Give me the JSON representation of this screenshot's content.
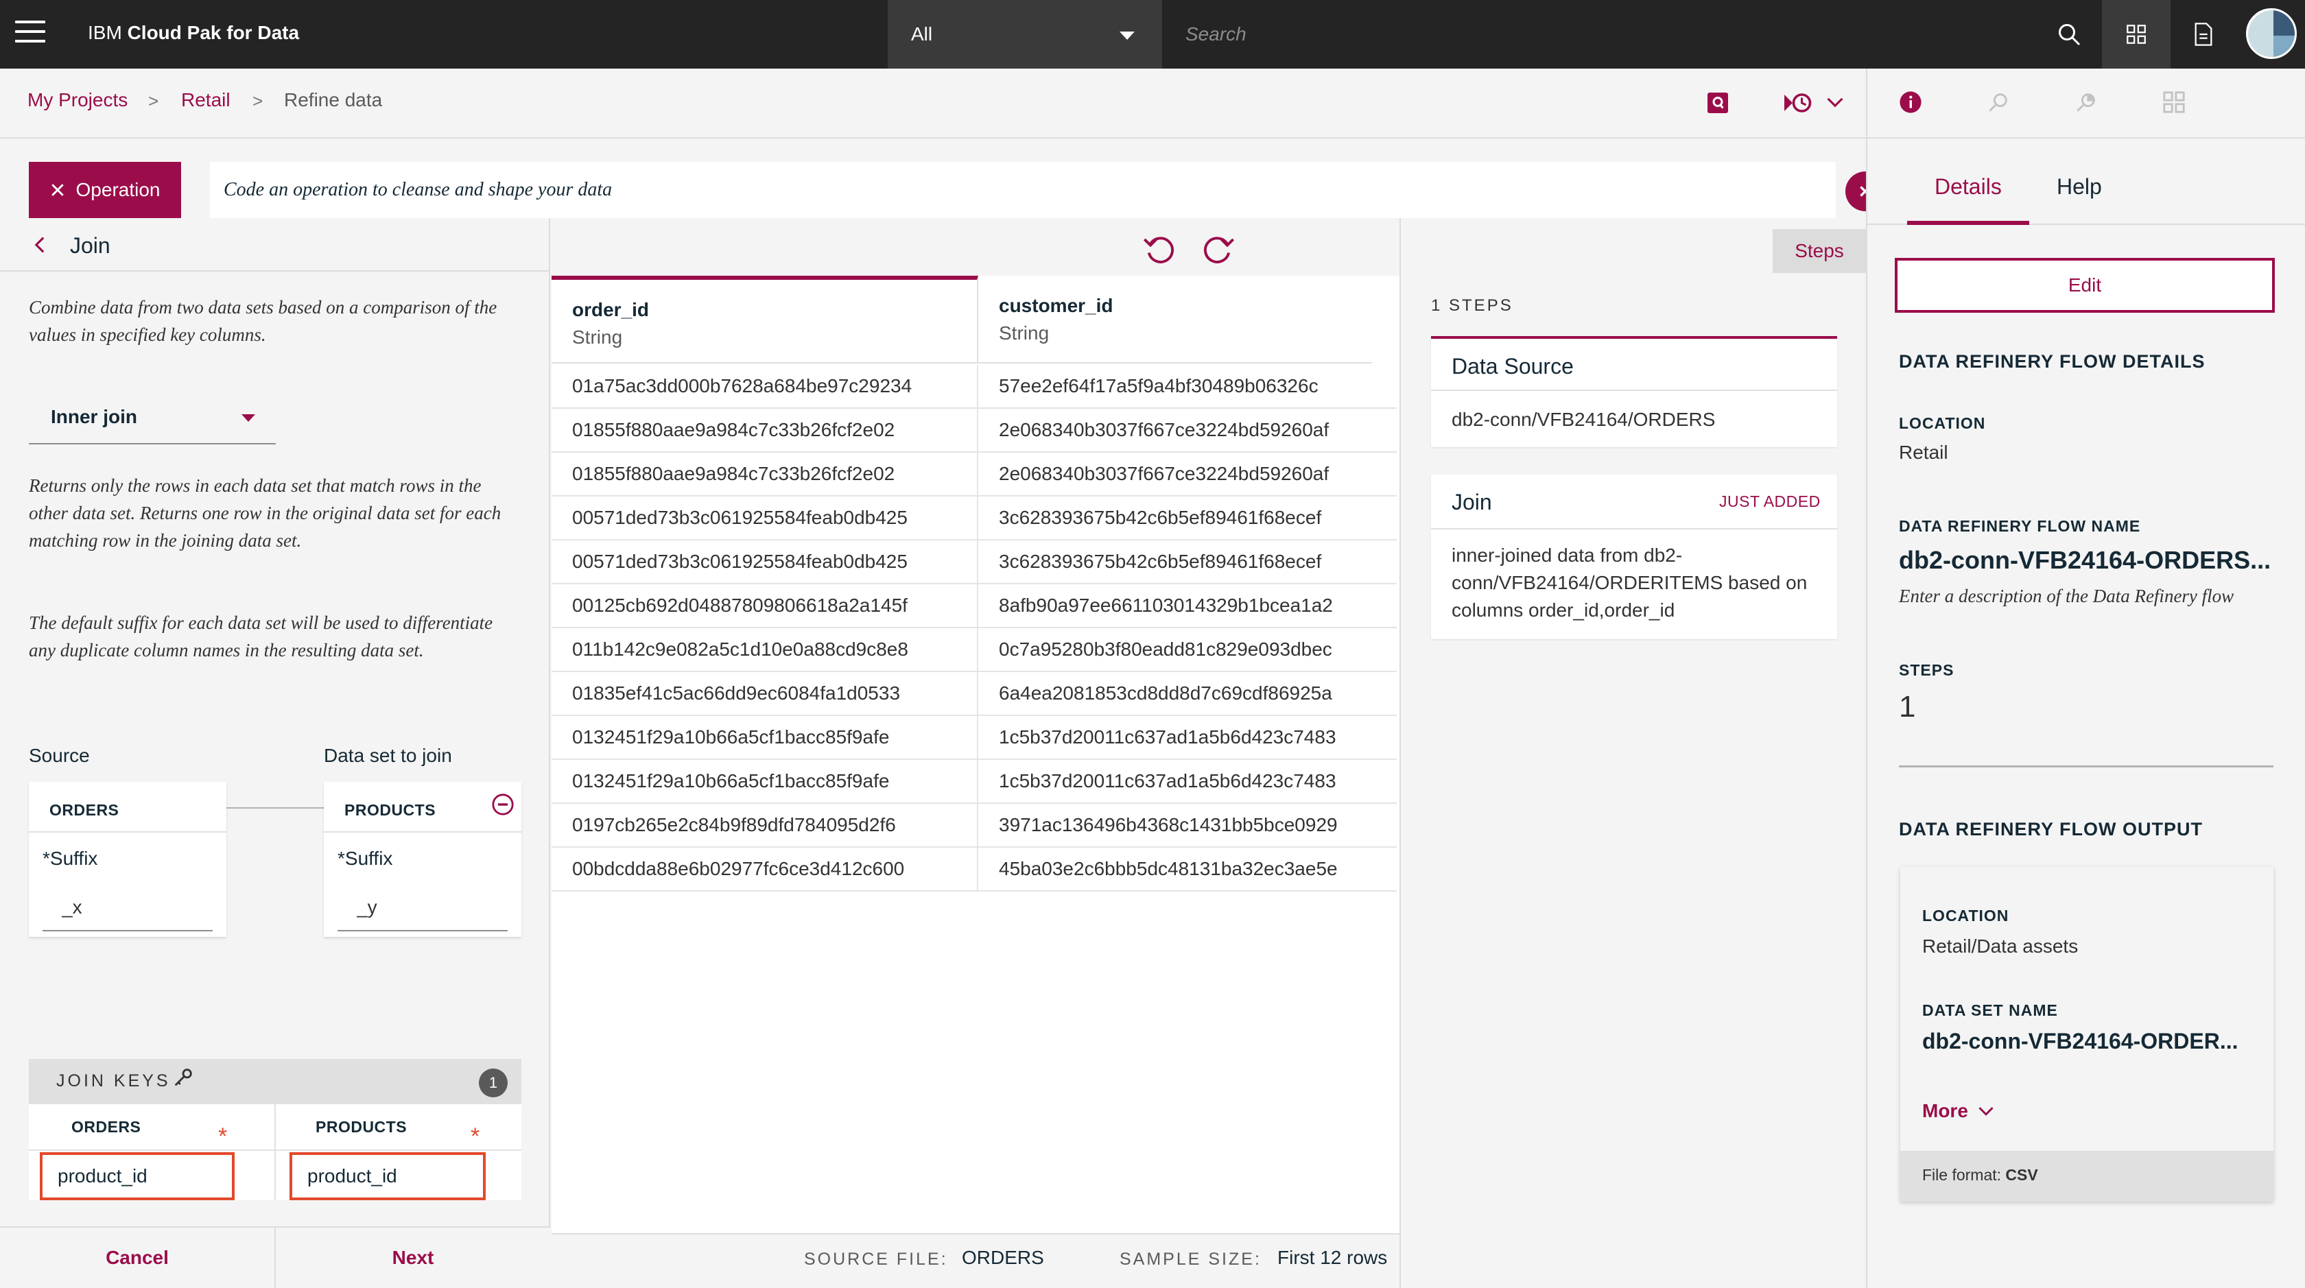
{
  "topbar": {
    "brand_prefix": "IBM",
    "brand_name": "Cloud Pak for Data",
    "scope_value": "All",
    "search_placeholder": "Search"
  },
  "breadcrumb": {
    "items": [
      "My Projects",
      "Retail",
      "Refine data"
    ],
    "separator": ">"
  },
  "operation": {
    "button_label": "Operation",
    "input_placeholder": "Code an operation to cleanse and shape your data"
  },
  "join_panel": {
    "title": "Join",
    "description": "Combine data from two data sets based on a comparison of the values in specified key columns.",
    "join_type": "Inner join",
    "join_type_description": "Returns only the rows in each data set that match rows in the other data set. Returns one row in the original data set for each matching row in the joining data set.",
    "suffix_description": "The default suffix for each data set will be used to differentiate any duplicate column names in the resulting data set.",
    "source_label": "Source",
    "join_label": "Data set to join",
    "source_name": "ORDERS",
    "join_name": "PRODUCTS",
    "suffix_label": "*Suffix",
    "source_suffix": "_x",
    "join_suffix": "_y",
    "keys_title": "JOIN KEYS",
    "keys_count": "1",
    "keys_col_left": "ORDERS",
    "keys_col_right": "PRODUCTS",
    "key_left": "product_id",
    "key_right": "product_id",
    "cancel_label": "Cancel",
    "next_label": "Next"
  },
  "grid": {
    "columns": [
      {
        "name": "order_id",
        "type": "String"
      },
      {
        "name": "customer_id",
        "type": "String"
      }
    ],
    "rows": [
      [
        "01a75ac3dd000b7628a684be97c29234",
        "57ee2ef64f17a5f9a4bf30489b06326c"
      ],
      [
        "01855f880aae9a984c7c33b26fcf2e02",
        "2e068340b3037f667ce3224bd59260af"
      ],
      [
        "01855f880aae9a984c7c33b26fcf2e02",
        "2e068340b3037f667ce3224bd59260af"
      ],
      [
        "00571ded73b3c061925584feab0db425",
        "3c628393675b42c6b5ef89461f68ecef"
      ],
      [
        "00571ded73b3c061925584feab0db425",
        "3c628393675b42c6b5ef89461f68ecef"
      ],
      [
        "00125cb692d04887809806618a2a145f",
        "8afb90a97ee661103014329b1bcea1a2"
      ],
      [
        "011b142c9e082a5c1d10e0a88cd9c8e8",
        "0c7a95280b3f80eadd81c829e093dbec"
      ],
      [
        "01835ef41c5ac66dd9ec6084fa1d0533",
        "6a4ea2081853cd8dd8d7c69cdf86925a"
      ],
      [
        "0132451f29a10b66a5cf1bacc85f9afe",
        "1c5b37d20011c637ad1a5b6d423c7483"
      ],
      [
        "0132451f29a10b66a5cf1bacc85f9afe",
        "1c5b37d20011c637ad1a5b6d423c7483"
      ],
      [
        "0197cb265e2c84b9f89dfd784095d2f6",
        "3971ac136496b4368c1431bb5bce0929"
      ],
      [
        "00bdcdda88e6b02977fc6ce3d412c600",
        "45ba03e2c6bbb5dc48131ba32ec3ae5e"
      ]
    ],
    "source_file_label": "SOURCE FILE:",
    "source_file_value": "ORDERS",
    "sample_size_label": "SAMPLE SIZE:",
    "sample_size_value": "First 12 rows"
  },
  "steps": {
    "button_label": "Steps",
    "count_label": "1 STEPS",
    "data_source_title": "Data Source",
    "data_source_value": "db2-conn/VFB24164/ORDERS",
    "join_title": "Join",
    "join_badge": "JUST ADDED",
    "join_description": "inner-joined data from db2-conn/VFB24164/ORDERITEMS based on columns order_id,order_id"
  },
  "details": {
    "tab_details": "Details",
    "tab_help": "Help",
    "edit_label": "Edit",
    "flow_details_title": "DATA REFINERY FLOW DETAILS",
    "location_label": "LOCATION",
    "location_value": "Retail",
    "flow_name_label": "DATA REFINERY FLOW NAME",
    "flow_name_value": "db2-conn-VFB24164-ORDERS...",
    "flow_desc_placeholder": "Enter a description of the Data Refinery flow",
    "steps_label": "STEPS",
    "steps_value": "1",
    "output_title": "DATA REFINERY FLOW OUTPUT",
    "output_location_label": "LOCATION",
    "output_location_value": "Retail/Data assets",
    "dataset_name_label": "DATA SET NAME",
    "dataset_name_value": "db2-conn-VFB24164-ORDER...",
    "more_label": "More",
    "file_format_label": "File format:",
    "file_format_value": "CSV"
  },
  "colors": {
    "accent": "#9b0d4a",
    "topbar": "#242424",
    "error": "#e24a2b"
  }
}
